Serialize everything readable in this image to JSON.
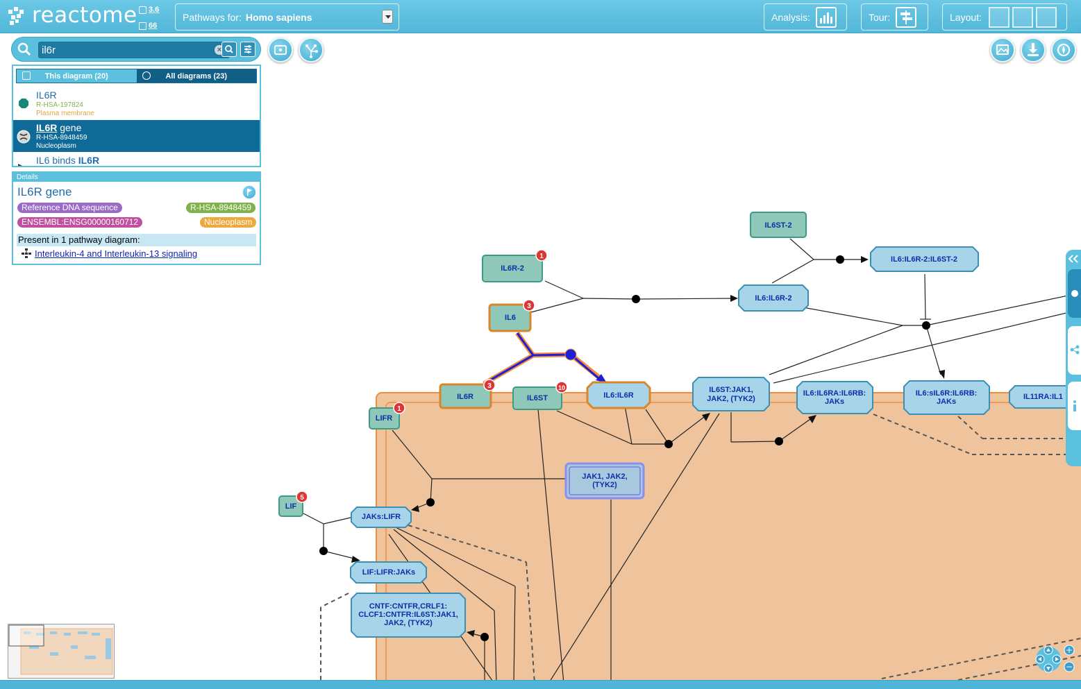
{
  "header": {
    "logo_text": "reactome",
    "version_label": "3.6",
    "count_label": "66",
    "species_prefix": "Pathways for:",
    "species_value": "Homo sapiens",
    "analysis_label": "Analysis:",
    "tour_label": "Tour:",
    "layout_label": "Layout:"
  },
  "search": {
    "value": "il6r",
    "tab_this": "This diagram (20)",
    "tab_all": "All diagrams (23)",
    "results": [
      {
        "name": "IL6R",
        "id": "R-HSA-197824",
        "location": "Plasma membrane",
        "selected": false
      },
      {
        "name_hl": "IL6R",
        "name_rest": " gene",
        "id": "R-HSA-8948459",
        "location": "Nucleoplasm",
        "selected": true
      },
      {
        "name_pre": "IL6 binds ",
        "name_hl": "IL6R",
        "selected": false
      }
    ]
  },
  "details": {
    "header": "Details",
    "title": "IL6R gene",
    "type_pill": "Reference DNA sequence",
    "id_pill": "R-HSA-8948459",
    "ensembl_pill": "ENSEMBL:ENSG00000160712",
    "compartment_pill": "Nucleoplasm",
    "present_text": "Present in 1 pathway diagram:",
    "pathway_link": "Interleukin-4 and Interleukin-13 signaling"
  },
  "diagram": {
    "nodes": {
      "il6st2": "IL6ST-2",
      "il6r2": "IL6R-2",
      "il6r2_badge": "1",
      "il6": "IL6",
      "il6_badge": "3",
      "il6_il6r2": "IL6:IL6R-2",
      "il6_il6r2_il6st2": "IL6:IL6R-2:IL6ST-2",
      "il6r": "IL6R",
      "il6r_badge": "3",
      "il6st": "IL6ST",
      "il6st_badge": "10",
      "il6_il6r": "IL6:IL6R",
      "il6st_jak_1": "IL6ST:JAK1,",
      "il6st_jak_2": "JAK2, (TYK2)",
      "il6_il6ra_1": "IL6:IL6RA:IL6RB:",
      "il6_il6ra_2": "JAKs",
      "il6_sil6r_1": "IL6:sIL6R:IL6RB:",
      "il6_sil6r_2": "JAKs",
      "il11ra": "IL11RA:IL1",
      "lifr": "LIFR",
      "lifr_badge": "1",
      "jak_1": "JAK1, JAK2,",
      "jak_2": "(TYK2)",
      "lif": "LIF",
      "lif_badge": "5",
      "jaks_lifr": "JAKs:LIFR",
      "lif_lifr_jaks": "LIF:LIFR:JAKs",
      "cntf_1": "CNTF:CNTFR,CRLF1:",
      "cntf_2": "CLCF1:CNTFR:IL6ST:JAK1,",
      "cntf_3": "JAK2, (TYK2)"
    }
  },
  "colors": {
    "header": "#5bc0de",
    "compartment": "#f0c49a",
    "compartment_border": "#f08c3c",
    "protein": "#8fc7b8",
    "complex": "#a8d4ea",
    "selection": "#1d1fd6"
  }
}
